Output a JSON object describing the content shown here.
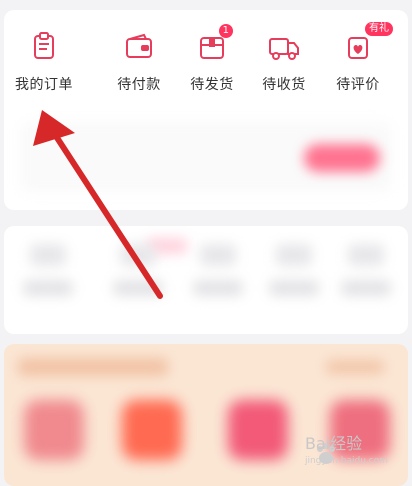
{
  "order_bar": {
    "items": [
      {
        "label": "我的订单",
        "icon": "clipboard-icon"
      },
      {
        "label": "待付款",
        "icon": "wallet-icon"
      },
      {
        "label": "待发货",
        "icon": "package-icon",
        "badge": "1"
      },
      {
        "label": "待收货",
        "icon": "truck-icon"
      },
      {
        "label": "待评价",
        "icon": "heart-bag-icon",
        "badge": "有礼"
      }
    ]
  },
  "watermark": {
    "brand": "Bai",
    "tail": "经验",
    "sub": "jingyan.baidu.com"
  },
  "colors": {
    "accent": "#e63d5c",
    "badge": "#ff3560",
    "arrow": "#d62828",
    "promo_bg": "#fbe6d4"
  }
}
